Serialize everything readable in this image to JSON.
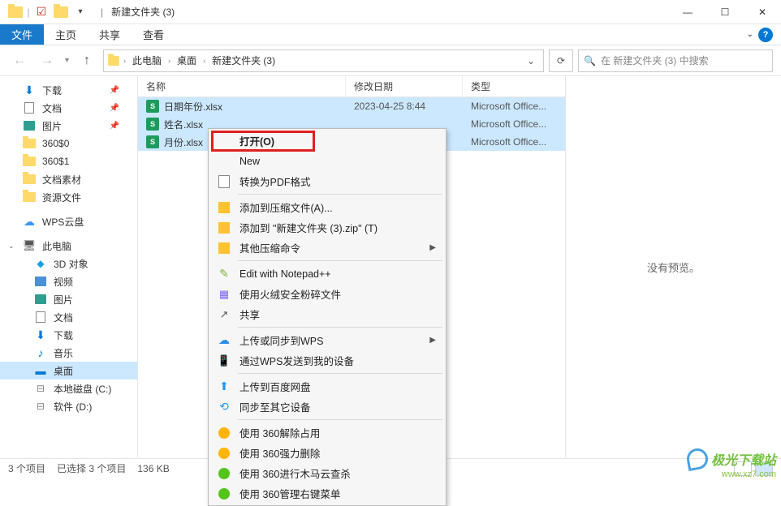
{
  "title": "新建文件夹 (3)",
  "ribbon": {
    "file": "文件",
    "tabs": [
      "主页",
      "共享",
      "查看"
    ]
  },
  "breadcrumb": [
    "此电脑",
    "桌面",
    "新建文件夹 (3)"
  ],
  "search": {
    "placeholder": "在 新建文件夹 (3) 中搜索"
  },
  "nav": {
    "quick": [
      {
        "label": "下载",
        "pin": true,
        "icon": "download"
      },
      {
        "label": "文档",
        "pin": true,
        "icon": "doc"
      },
      {
        "label": "图片",
        "pin": true,
        "icon": "pic"
      },
      {
        "label": "360$0",
        "pin": false,
        "icon": "folder"
      },
      {
        "label": "360$1",
        "pin": false,
        "icon": "folder"
      },
      {
        "label": "文档素材",
        "pin": false,
        "icon": "folder"
      },
      {
        "label": "资源文件",
        "pin": false,
        "icon": "folder"
      }
    ],
    "wps": "WPS云盘",
    "pc": "此电脑",
    "pc_items": [
      {
        "label": "3D 对象",
        "icon": "3d"
      },
      {
        "label": "视频",
        "icon": "vid"
      },
      {
        "label": "图片",
        "icon": "pic"
      },
      {
        "label": "文档",
        "icon": "doc"
      },
      {
        "label": "下载",
        "icon": "download"
      },
      {
        "label": "音乐",
        "icon": "music"
      },
      {
        "label": "桌面",
        "icon": "desktop",
        "selected": true
      },
      {
        "label": "本地磁盘 (C:)",
        "icon": "drive"
      },
      {
        "label": "软件 (D:)",
        "icon": "drive"
      }
    ]
  },
  "columns": {
    "name": "名称",
    "date": "修改日期",
    "type": "类型"
  },
  "files": [
    {
      "name": "日期年份.xlsx",
      "date": "2023-04-25 8:44",
      "type": "Microsoft Office..."
    },
    {
      "name": "姓名.xlsx",
      "date": "",
      "type": "Microsoft Office..."
    },
    {
      "name": "月份.xlsx",
      "date": "",
      "type": "Microsoft Office..."
    }
  ],
  "preview": "没有预览。",
  "status": {
    "count": "3 个项目",
    "selected": "已选择 3 个项目",
    "size": "136 KB"
  },
  "ctx": {
    "open": "打开(O)",
    "new": "New",
    "pdf": "转换为PDF格式",
    "add_archive": "添加到压缩文件(A)...",
    "add_zip": "添加到 \"新建文件夹 (3).zip\" (T)",
    "other_zip": "其他压缩命令",
    "notepad": "Edit with Notepad++",
    "shred": "使用火绒安全粉碎文件",
    "share": "共享",
    "wps_sync": "上传或同步到WPS",
    "wps_send": "通过WPS发送到我的设备",
    "baidu": "上传到百度网盘",
    "sync_other": "同步至其它设备",
    "u360_1": "使用 360解除占用",
    "u360_2": "使用 360强力删除",
    "u360_3": "使用 360进行木马云查杀",
    "u360_4": "使用 360管理右键菜单"
  },
  "watermark": {
    "text": "极光下载站",
    "url": "www.xz7.com"
  }
}
